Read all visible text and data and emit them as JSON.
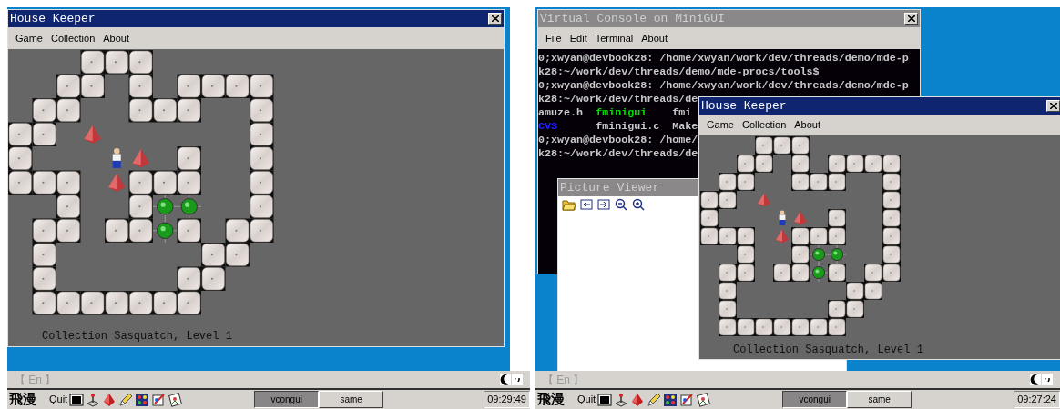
{
  "screens": [
    {
      "windows": [
        {
          "kind": "game",
          "title": "House Keeper",
          "active": true,
          "menu": [
            "Game",
            "Collection",
            "About"
          ],
          "status": "Collection Sasquatch, Level 1"
        }
      ],
      "ime": "【 En 】",
      "taskbar": {
        "logo": "飛漫",
        "quit": "Quit",
        "tasks": [
          {
            "label": "vcongui",
            "selected": true
          },
          {
            "label": "same",
            "selected": false
          }
        ],
        "clock": "09:29:49"
      }
    },
    {
      "windows": [
        {
          "kind": "console",
          "title": "Virtual Console on MiniGUI",
          "active": false,
          "menu": [
            "File",
            "Edit",
            "Terminal",
            "About"
          ],
          "lines": [
            [
              {
                "text": "0;xwyan@devbook28: /home/xwyan/work/dev/threads/demo/mde-p",
                "color": "#c8c8c8"
              }
            ],
            [
              {
                "text": "k28:~/work/dev/threads/demo/mde-procs/tools$",
                "color": "#c8c8c8"
              }
            ],
            [
              {
                "text": "0;xwyan@devbook28: /home/xwyan/work/dev/threads/demo/mde-p",
                "color": "#c8c8c8"
              }
            ],
            [
              {
                "text": "k28:~/work/dev/threads/de",
                "color": "#c8c8c8"
              }
            ],
            [
              {
                "text": "amuze.h  ",
                "color": "#c8c8c8"
              },
              {
                "text": "fminigui    ",
                "color": "#00e000"
              },
              {
                "text": "fmi",
                "color": "#c8c8c8"
              }
            ],
            [
              {
                "text": "CVS",
                "color": "#2020ff"
              },
              {
                "text": "      fminigui.c  Make",
                "color": "#c8c8c8"
              }
            ],
            [
              {
                "text": "0;xwyan@devbook28: /home/",
                "color": "#c8c8c8"
              }
            ],
            [
              {
                "text": "k28:~/work/dev/threads/de",
                "color": "#c8c8c8"
              }
            ]
          ]
        },
        {
          "kind": "viewer",
          "title": "Picture Viewer",
          "active": false
        },
        {
          "kind": "game",
          "title": "House Keeper",
          "active": true,
          "menu": [
            "Game",
            "Collection",
            "About"
          ],
          "status": "Collection Sasquatch, Level 1"
        }
      ],
      "ime": "【 En 】",
      "taskbar": {
        "logo": "飛漫",
        "quit": "Quit",
        "tasks": [
          {
            "label": "vcongui",
            "selected": true
          },
          {
            "label": "same",
            "selected": false
          }
        ],
        "clock": "09:27:24"
      }
    }
  ]
}
